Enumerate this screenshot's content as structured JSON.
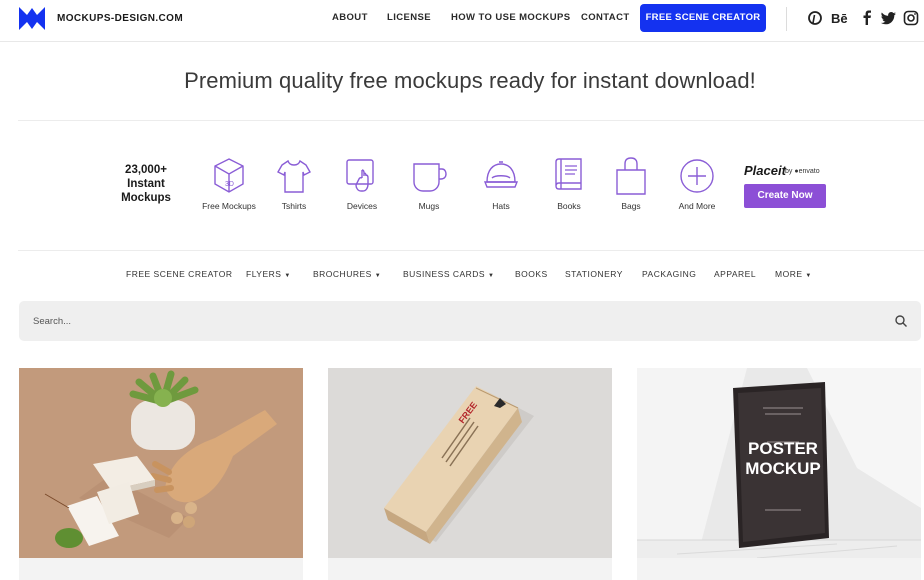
{
  "header": {
    "brand": "MOCKUPS-DESIGN.COM",
    "nav": [
      "ABOUT",
      "LICENSE",
      "HOW TO USE MOCKUPS",
      "CONTACT"
    ],
    "cta": "FREE SCENE CREATOR",
    "social_icons": [
      "pinterest-icon",
      "behance-icon",
      "facebook-icon",
      "twitter-icon",
      "instagram-icon"
    ]
  },
  "tagline": "Premium quality free mockups ready for instant download!",
  "categories": {
    "count_lines": [
      "23,000+",
      "Instant",
      "Mockups"
    ],
    "items": [
      {
        "label": "Free Mockups",
        "icon": "cube-3d-icon"
      },
      {
        "label": "Tshirts",
        "icon": "tshirt-icon"
      },
      {
        "label": "Devices",
        "icon": "device-icon"
      },
      {
        "label": "Mugs",
        "icon": "mug-icon"
      },
      {
        "label": "Hats",
        "icon": "hat-icon"
      },
      {
        "label": "Books",
        "icon": "book-icon"
      },
      {
        "label": "Bags",
        "icon": "bag-icon"
      },
      {
        "label": "And More",
        "icon": "plus-circle-icon"
      }
    ],
    "placeit": {
      "brand": "Placeit",
      "by": "by ●envato",
      "button": "Create Now"
    }
  },
  "subnav": [
    {
      "label": "FREE SCENE CREATOR",
      "dropdown": false
    },
    {
      "label": "FLYERS",
      "dropdown": true
    },
    {
      "label": "BROCHURES",
      "dropdown": true
    },
    {
      "label": "BUSINESS CARDS",
      "dropdown": true
    },
    {
      "label": "BOOKS",
      "dropdown": false
    },
    {
      "label": "STATIONERY",
      "dropdown": false
    },
    {
      "label": "PACKAGING",
      "dropdown": false
    },
    {
      "label": "APPAREL",
      "dropdown": false
    },
    {
      "label": "MORE",
      "dropdown": true
    }
  ],
  "search": {
    "placeholder": "Search..."
  },
  "cards": {
    "poster_lines": [
      "POSTER",
      "MOCKUP"
    ],
    "box_label": "FREE"
  },
  "colors": {
    "accent_blue": "#1432f0",
    "placeit_purple": "#8c4fd6"
  }
}
